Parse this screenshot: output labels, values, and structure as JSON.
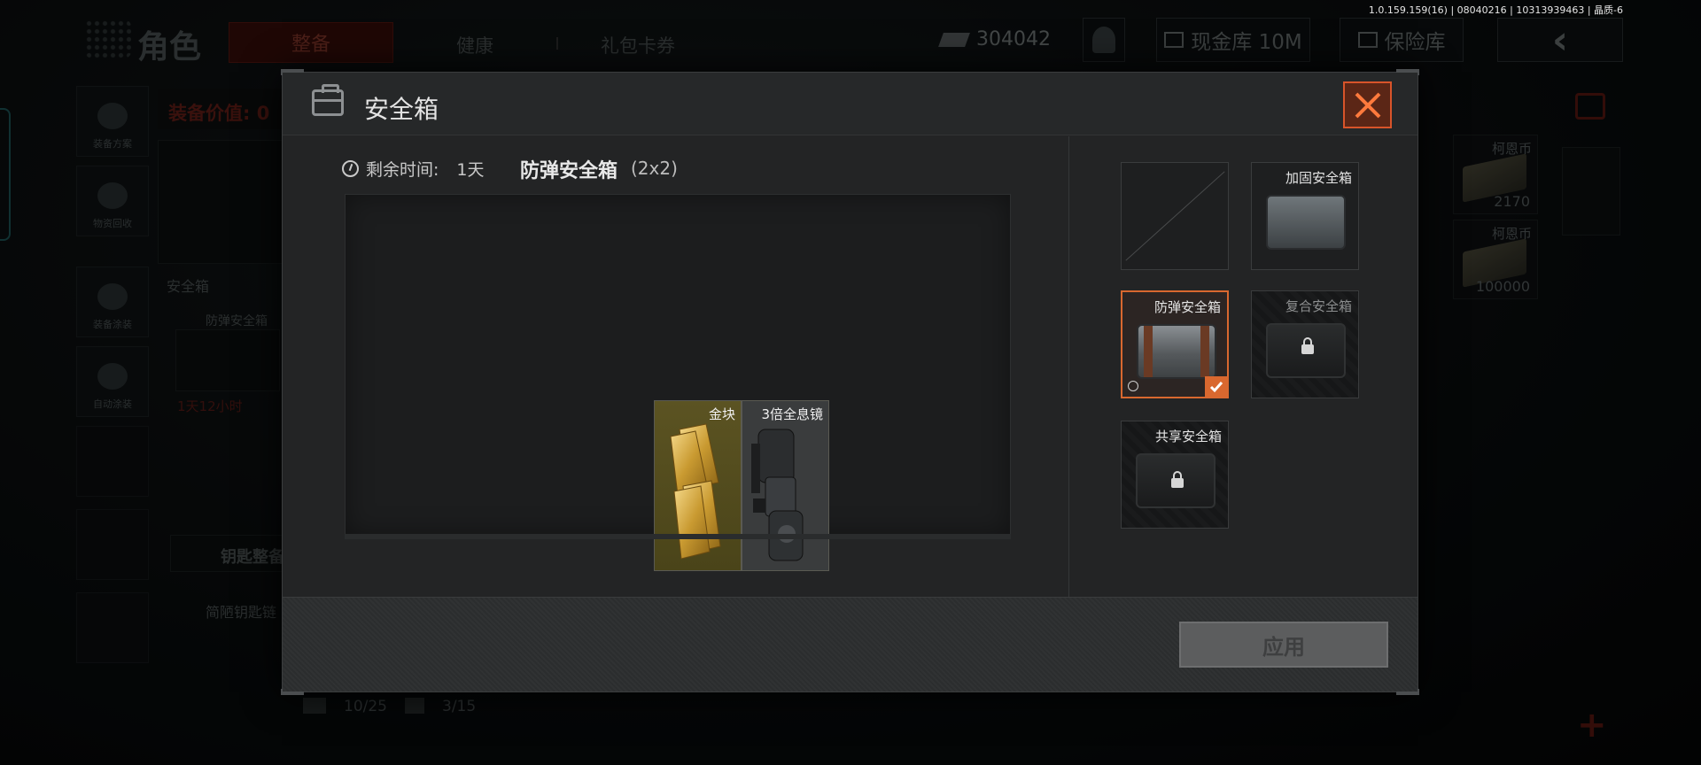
{
  "version_info": "1.0.159.159(16) | 08040216 | 10313939463 | 晶质-6",
  "background": {
    "page_title": "角色",
    "tabs": [
      {
        "label": "整备",
        "active": true
      },
      {
        "label": "健康",
        "active": false
      },
      {
        "label": "礼包卡券",
        "active": false
      }
    ],
    "currency_amount": "304042",
    "cash_vault_label": "现金库 10M",
    "safe_vault_label": "保险库",
    "back_icon": "chevron-left-icon",
    "dock": [
      {
        "label": "装备方案",
        "icon": "helmet-icon"
      },
      {
        "label": "物资回收",
        "icon": "recycle-icon"
      },
      {
        "label": "装备涂装",
        "icon": "helmet-paint-icon"
      },
      {
        "label": "自动涂装",
        "icon": "brush-icon"
      }
    ],
    "equip_value": "装备价值: 0",
    "safebox_section_label": "安全箱",
    "safebox_item_name": "防弹安全箱",
    "safebox_remaining": "1天12小时",
    "key_setup_label": "钥匙整备",
    "keychain_label": "简陋钥匙链",
    "stats": [
      {
        "icon": "bullet-icon",
        "value": "10/25"
      },
      {
        "icon": "bandage-icon",
        "value": "3/15"
      }
    ],
    "right_items": [
      {
        "name": "柯恩币",
        "qty": "2170"
      },
      {
        "name": "柯恩币",
        "qty": "100000"
      }
    ]
  },
  "modal": {
    "title": "安全箱",
    "title_icon": "briefcase-icon",
    "close_icon": "close-icon",
    "timer_label": "剩余时间:",
    "timer_value": "1天",
    "box_name": "防弹安全箱",
    "box_size": "(2x2)",
    "contents": [
      {
        "name": "金块",
        "icon": "gold-bars-icon"
      },
      {
        "name": "3倍全息镜",
        "icon": "holo-scope-icon"
      }
    ],
    "slots": [
      {
        "name": "",
        "state": "empty"
      },
      {
        "name": "加固安全箱",
        "state": "available"
      },
      {
        "name": "防弹安全箱",
        "state": "selected"
      },
      {
        "name": "复合安全箱",
        "state": "locked"
      },
      {
        "name": "共享安全箱",
        "state": "locked"
      }
    ],
    "apply_label": "应用"
  },
  "colors": {
    "accent": "#d9682f",
    "gold": "#c4952e",
    "modal_bg": "#232425"
  }
}
